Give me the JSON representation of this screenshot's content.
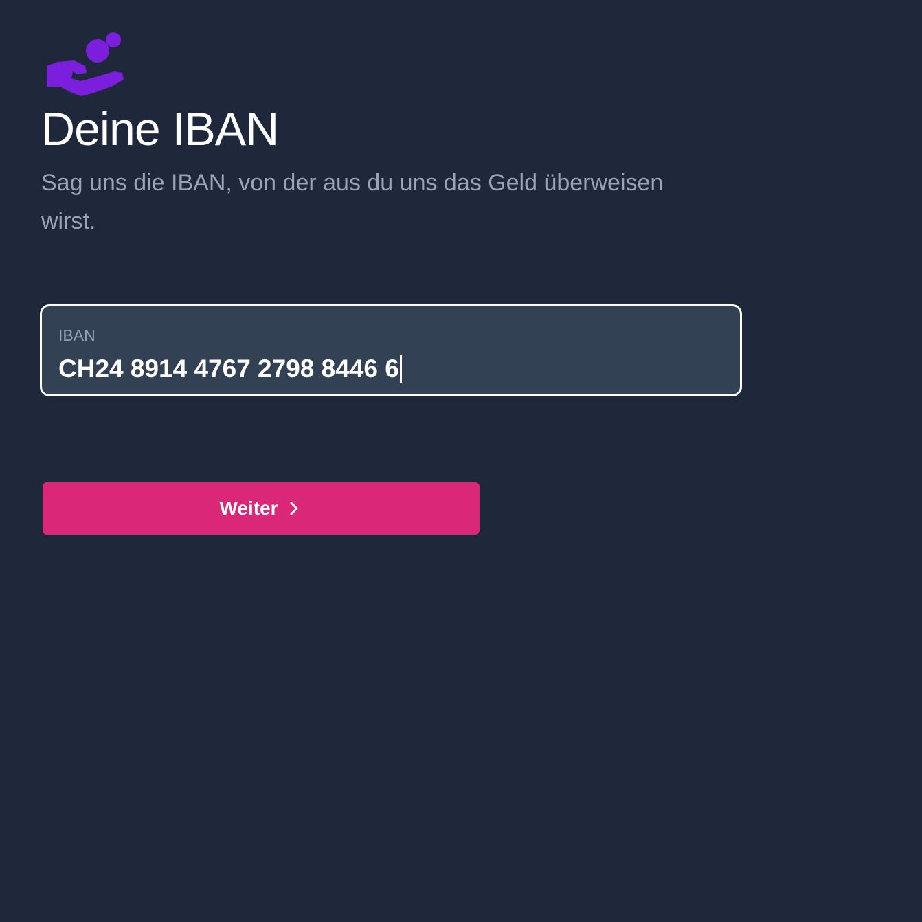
{
  "logo": {
    "icon": "hand-coin-icon",
    "color": "#7c1fdd"
  },
  "header": {
    "title": "Deine IBAN",
    "subtitle": "Sag uns die IBAN, von der aus du uns das Geld überweisen wirst."
  },
  "form": {
    "iban_label": "IBAN",
    "iban_value": "CH24 8914 4767 2798 8446 6"
  },
  "button": {
    "label": "Weiter",
    "icon": "chevron-right-icon",
    "color": "#db2777"
  }
}
